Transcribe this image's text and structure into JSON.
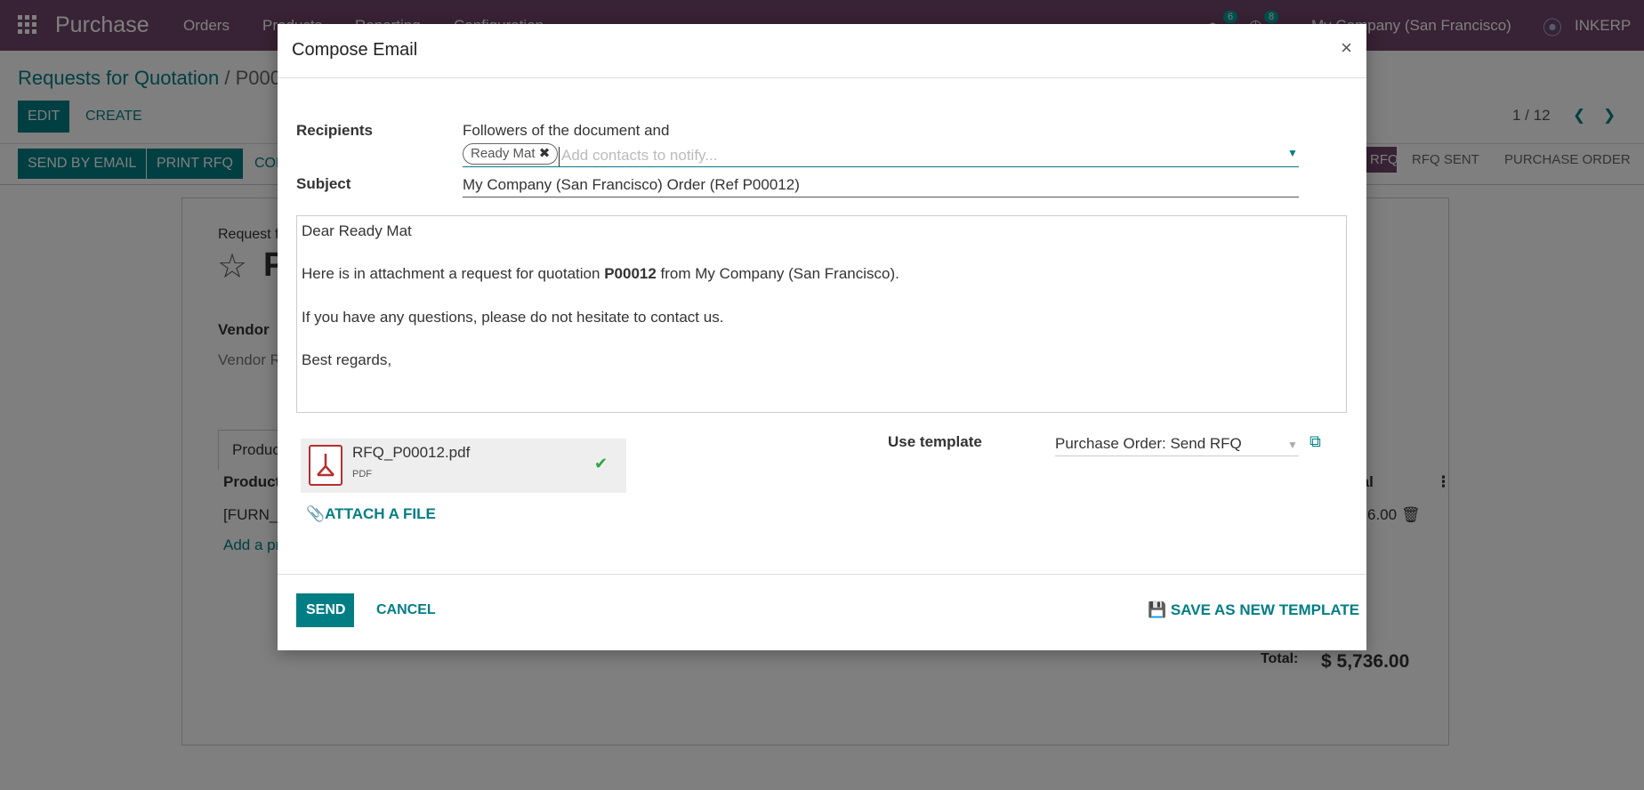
{
  "navbar": {
    "app_name": "Purchase",
    "menu": [
      "Orders",
      "Products",
      "Reporting",
      "Configuration"
    ],
    "chat_count": "6",
    "activity_count": "8",
    "company": "My Company (San Francisco)",
    "brand": "INKERP"
  },
  "breadcrumb": {
    "parent": "Requests for Quotation",
    "separator": "/",
    "current": "P000"
  },
  "control": {
    "edit": "EDIT",
    "create": "CREATE",
    "pager": "1 / 12",
    "send_by_email": "SEND BY EMAIL",
    "print_rfq": "PRINT RFQ",
    "confirm_partial": "CON"
  },
  "statusbar": {
    "rfq": "RFQ",
    "rfq_sent": "RFQ SENT",
    "purchase_order": "PURCHASE ORDER"
  },
  "background_form": {
    "title_label": "Request f",
    "name_partial": "P",
    "vendor_label": "Vendor",
    "vendor_ref": "Vendor Re",
    "products_tab": "Produc",
    "product_col": "Product",
    "total_col": "tal",
    "product_line": "[FURN_6",
    "line_subtotal": "6.00",
    "add_product": "Add a pro",
    "total_label": "Total:",
    "total_value": "$ 5,736.00"
  },
  "dialog": {
    "title": "Compose Email",
    "recipients_label": "Recipients",
    "followers_text": "Followers of the document and",
    "recipient_tag": "Ready Mat",
    "contacts_placeholder": "Add contacts to notify...",
    "subject_label": "Subject",
    "subject_value": "My Company (San Francisco) Order (Ref P00012)",
    "body": {
      "greeting": "Dear Ready Mat",
      "line1_before": "Here is in attachment a request for quotation ",
      "line1_bold": "P00012",
      "line1_after": " from My Company (San Francisco).",
      "line2": "If you have any questions, please do not hesitate to contact us.",
      "line3": "Best regards,"
    },
    "attachment_name": "RFQ_P00012.pdf",
    "attachment_type": "PDF",
    "attach_file": "ATTACH A FILE",
    "use_template_label": "Use template",
    "template_value": "Purchase Order: Send RFQ",
    "send": "SEND",
    "cancel": "CANCEL",
    "save_template": "SAVE AS NEW TEMPLATE"
  },
  "colors": {
    "navbar": "#71456a",
    "primary": "#017e84",
    "success": "#28a745",
    "pdf_red": "#b82e2e"
  }
}
